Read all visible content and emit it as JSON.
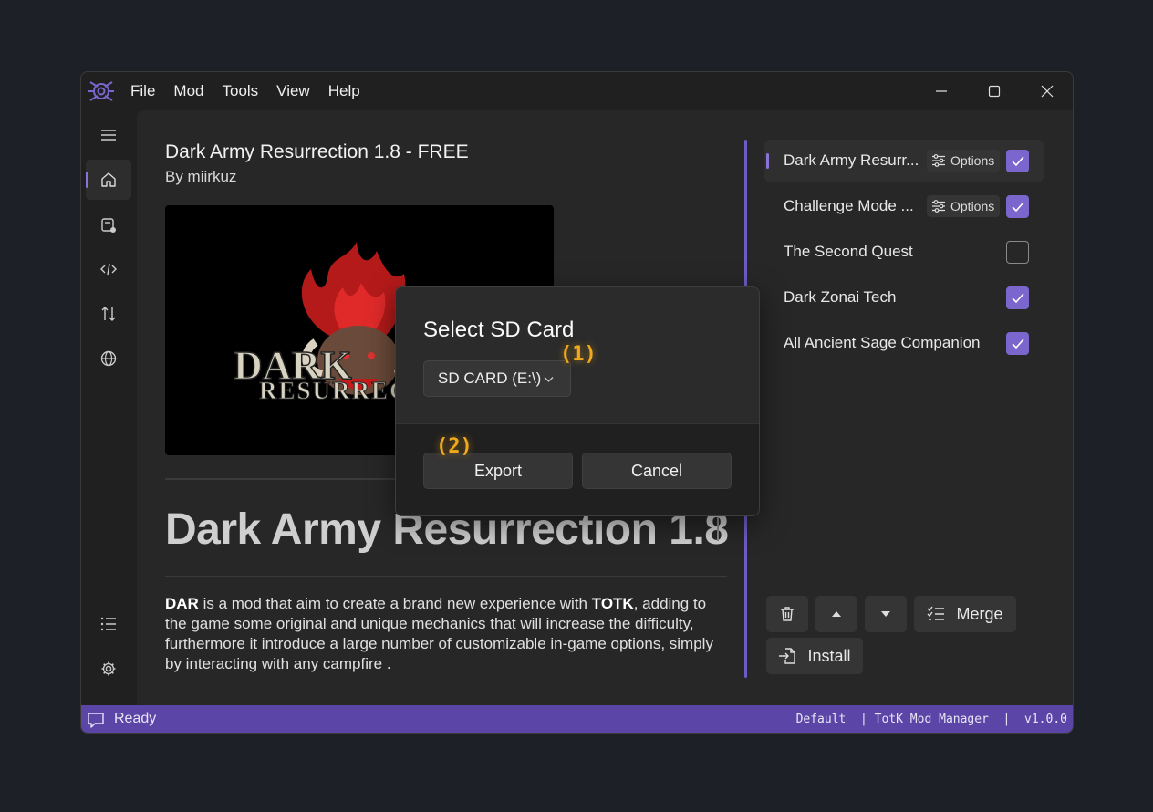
{
  "menu": [
    "File",
    "Mod",
    "Tools",
    "View",
    "Help"
  ],
  "mod": {
    "title": "Dark Army Resurrection 1.8 - FREE",
    "author": "By miirkuz",
    "image_logo_top": "DARK",
    "image_logo_bottom": "RESURREC",
    "heading": "Dark Army Resurrection 1.8",
    "desc_b1": "DAR",
    "desc_t1": " is a mod that aim to create a brand new experience with ",
    "desc_b2": "TOTK",
    "desc_t2": ", adding to the game some original and unique mechanics that will increase the difficulty, furthermore it introduce a large number of customizable in-game options, simply by interacting with any campfire ."
  },
  "mod_list": [
    {
      "name": "Dark Army Resurr...",
      "options_label": "Options",
      "checked": true
    },
    {
      "name": "Challenge Mode ...",
      "options_label": "Options",
      "checked": true
    },
    {
      "name": "The Second Quest",
      "checked": false
    },
    {
      "name": "Dark Zonai Tech",
      "checked": true
    },
    {
      "name": "All Ancient Sage Companion",
      "checked": true
    }
  ],
  "actions": {
    "merge": "Merge",
    "install": "Install"
  },
  "status": {
    "text": "Ready",
    "right": "Default  | TotK Mod Manager  |  v1.0.0"
  },
  "dialog": {
    "title": "Select SD Card",
    "selected_drive": "SD CARD (E:\\)",
    "export": "Export",
    "cancel": "Cancel"
  },
  "annotations": {
    "a1": "(1)",
    "a2": "(2)"
  },
  "colors": {
    "accent": "#7a66cc",
    "statusbar": "#5b45a7",
    "annotation": "#f0a91c"
  }
}
